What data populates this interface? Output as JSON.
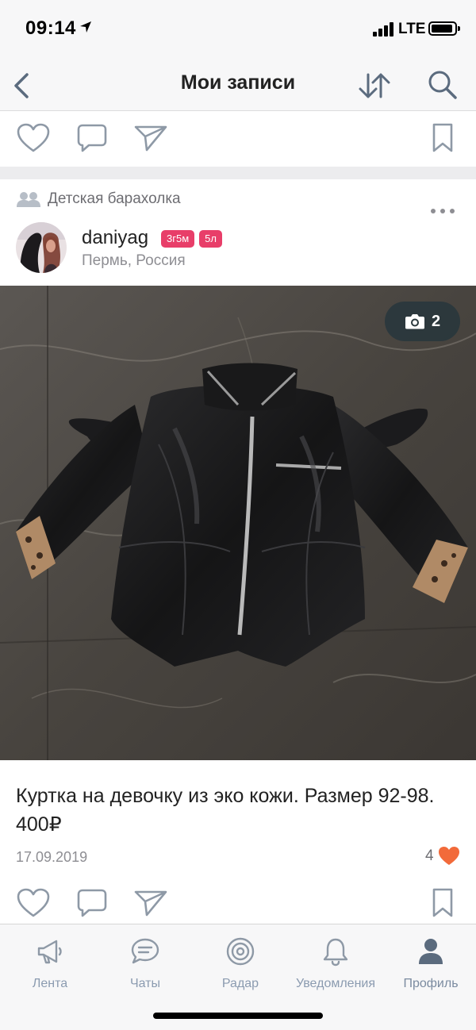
{
  "status_bar": {
    "time": "09:14",
    "network": "LTE"
  },
  "nav": {
    "title": "Мои записи",
    "icons": [
      "back-chevron-icon",
      "sort-icon",
      "search-icon"
    ]
  },
  "post": {
    "group": "Детская барахолка",
    "author": {
      "name": "daniyag",
      "badges": [
        "3г5м",
        "5л"
      ],
      "location": "Пермь, Россия"
    },
    "photo_count": "2",
    "text": "Куртка на девочку из эко кожи. Размер 92-98. 400₽",
    "date": "17.09.2019",
    "likes": "4"
  },
  "tabs": [
    {
      "label": "Лента",
      "icon": "megaphone-icon"
    },
    {
      "label": "Чаты",
      "icon": "chat-icon"
    },
    {
      "label": "Радар",
      "icon": "radar-icon"
    },
    {
      "label": "Уведомления",
      "icon": "bell-icon"
    },
    {
      "label": "Профиль",
      "icon": "profile-icon",
      "active": true
    }
  ],
  "colors": {
    "badge": "#e83e69",
    "like_heart": "#f26a3a",
    "icon_gray": "#8e99a6",
    "tab_label": "#8b9bb0",
    "bar_bg": "#f7f7f8"
  }
}
